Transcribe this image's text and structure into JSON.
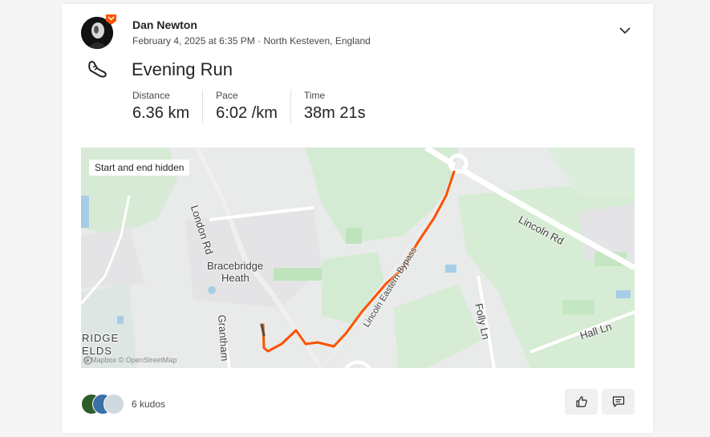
{
  "activity": {
    "athlete_name": "Dan Newton",
    "date": "February 4, 2025 at 6:35 PM",
    "separator": " · ",
    "location": "North Kesteven, England",
    "title": "Evening Run",
    "sport_icon": "running-shoe-icon"
  },
  "stats": [
    {
      "label": "Distance",
      "value": "6.36 km"
    },
    {
      "label": "Pace",
      "value": "6:02 /km"
    },
    {
      "label": "Time",
      "value": "38m 21s"
    }
  ],
  "map": {
    "privacy_badge": "Start and end hidden",
    "labels": {
      "london_rd": "London Rd",
      "lincoln_rd": "Lincoln Rd",
      "bracebridge": "Bracebridge",
      "heath": "Heath",
      "lincoln_eastern_bypass": "Lincoln Eastern Bypass",
      "folly_ln": "Folly Ln",
      "hall_ln": "Hall Ln",
      "grantham": "Grantham",
      "bridge": "RIDGE",
      "fields": "ELDS"
    },
    "attribution": "© Mapbox © OpenStreetMap",
    "route_color": "#fc5200"
  },
  "kudos": {
    "count_text": "6 kudos"
  },
  "colors": {
    "brand": "#fc5200",
    "green_area": "#d4ecd4",
    "road": "#ffffff"
  }
}
